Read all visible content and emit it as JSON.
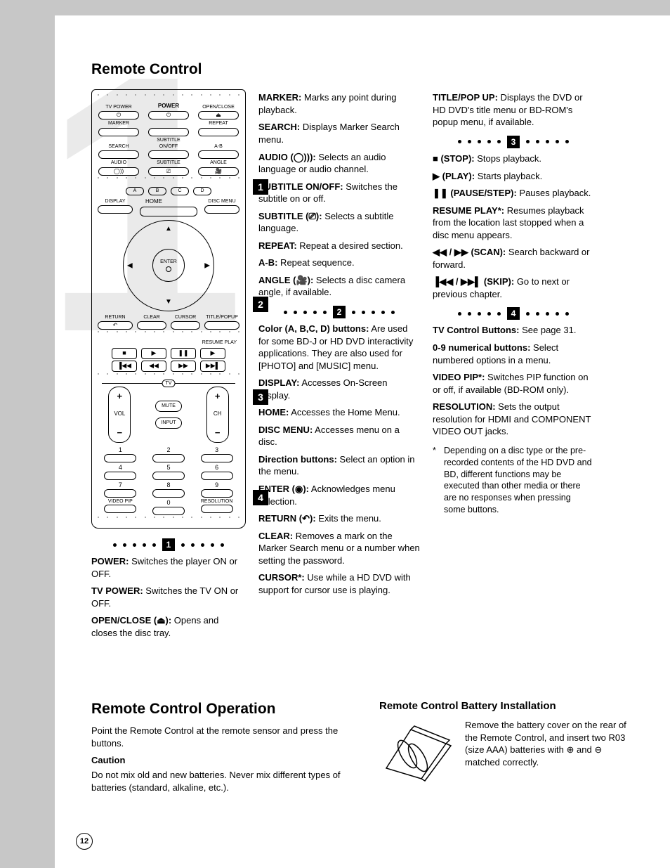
{
  "page_number": "12",
  "watermark": "1",
  "section1_title": "Remote Control",
  "markers": {
    "m1": "1",
    "m2": "2",
    "m3": "3",
    "m4": "4"
  },
  "remote": {
    "row1": [
      "TV POWER",
      "POWER",
      "OPEN/CLOSE"
    ],
    "row2": [
      "MARKER",
      "",
      "REPEAT"
    ],
    "row3": [
      "SEARCH",
      "SUBTITLE ON/OFF",
      "A-B"
    ],
    "row4": [
      "AUDIO",
      "SUBTITLE",
      "ANGLE"
    ],
    "colors": [
      "A",
      "B",
      "C",
      "D"
    ],
    "home": "HOME",
    "display": "DISPLAY",
    "discmenu": "DISC MENU",
    "enter": "ENTER",
    "return": "RETURN",
    "clear": "CLEAR",
    "cursor": "CURSOR",
    "titlepopup": "TITLE/POPUP",
    "resumeplay": "RESUME PLAY",
    "tv": "TV",
    "vol": "VOL",
    "ch": "CH",
    "mute": "MUTE",
    "input": "INPUT",
    "nums": [
      "1",
      "2",
      "3",
      "4",
      "5",
      "6",
      "7",
      "8",
      "9",
      "0"
    ],
    "videopip": "VIDEO PIP",
    "resolution": "RESOLUTION"
  },
  "col1_section1": [
    {
      "label": "POWER:",
      "text": " Switches the player ON or OFF."
    },
    {
      "label": "TV POWER:",
      "text": " Switches the TV ON or OFF."
    },
    {
      "label": "OPEN/CLOSE (",
      "sym": "⏏",
      "after": "):",
      "text": " Opens and closes the disc tray."
    }
  ],
  "col2_top": [
    {
      "label": "MARKER:",
      "text": " Marks any point during playback."
    },
    {
      "label": "SEARCH:",
      "text": " Displays Marker Search menu."
    },
    {
      "label": "AUDIO (",
      "sym": "◯))",
      "after": "):",
      "text": " Selects an audio language or audio channel."
    },
    {
      "label": "SUBTITLE ON/OFF:",
      "text": " Switches the subtitle on or off."
    },
    {
      "label": "SUBTITLE (",
      "sym": "⎚",
      "after": "):",
      "text": " Selects a subtitle language."
    },
    {
      "label": "REPEAT:",
      "text": " Repeat a desired section."
    },
    {
      "label": "A-B:",
      "text": " Repeat sequence."
    },
    {
      "label": "ANGLE (",
      "sym": "🎥",
      "after": "):",
      "text": " Selects a disc camera angle, if available."
    }
  ],
  "col2_section2": [
    {
      "label": "Color (A, B,C, D) buttons:",
      "text": " Are used for some BD-J or HD DVD interactivity applications. They are also used for [PHOTO] and [MUSIC] menu."
    },
    {
      "label": "DISPLAY:",
      "text": " Accesses On-Screen Display."
    },
    {
      "label": "HOME:",
      "text": " Accesses the Home Menu."
    },
    {
      "label": "DISC MENU:",
      "text": " Accesses menu on a disc."
    },
    {
      "label": "Direction buttons:",
      "text": " Select an option in the menu."
    },
    {
      "label": "ENTER (",
      "sym": "◉",
      "after": "):",
      "text": " Acknowledges menu selection."
    },
    {
      "label": "RETURN (",
      "sym": "↶",
      "after": "):",
      "text": " Exits the menu."
    },
    {
      "label": "CLEAR:",
      "text": " Removes a mark on the Marker Search menu or a number when setting the password."
    },
    {
      "label": "CURSOR*:",
      "text": " Use while a HD DVD with support for cursor use is playing."
    }
  ],
  "col3_top": [
    {
      "label": "TITLE/POP UP:",
      "text": " Displays the DVD or HD DVD's title menu or BD-ROM's popup menu, if available."
    }
  ],
  "col3_section3": [
    {
      "sym": "■",
      "label": " (STOP):",
      "text": " Stops playback."
    },
    {
      "sym": "▶",
      "label": " (PLAY):",
      "text": " Starts playback."
    },
    {
      "sym": "❚❚",
      "label": " (PAUSE/STEP):",
      "text": " Pauses playback."
    },
    {
      "label": "RESUME PLAY*:",
      "text": " Resumes playback from the location last stopped when a disc menu appears."
    },
    {
      "sym": "◀◀ / ▶▶",
      "label": " (SCAN):",
      "text": " Search backward or forward."
    },
    {
      "sym": "▐◀◀ / ▶▶▌",
      "label": " (SKIP):",
      "text": " Go to next or previous chapter."
    }
  ],
  "col3_section4": [
    {
      "label": "TV Control Buttons:",
      "text": " See page 31."
    },
    {
      "label": "0-9 numerical buttons:",
      "text": " Select numbered options in a menu."
    },
    {
      "label": "VIDEO PIP*:",
      "text": " Switches PIP function on or off, if available (BD-ROM only)."
    },
    {
      "label": "RESOLUTION:",
      "text": " Sets the output resolution for HDMI and COMPONENT VIDEO OUT jacks."
    }
  ],
  "col3_footnote": "Depending on a disc type or the pre-recorded contents of the HD DVD and BD, different functions may be executed than other media or there are no responses when pressing some buttons.",
  "section2_title": "Remote Control Operation",
  "section2_p1": "Point the Remote Control at the remote sensor and press the buttons.",
  "caution_label": "Caution",
  "caution_text": "Do not mix old and new batteries. Never mix different types of batteries (standard, alkaline, etc.).",
  "battery_title": "Remote Control Battery Installation",
  "battery_text_a": "Remove the battery cover on the rear of the Remote Control, and insert two R03 (size AAA) batteries with ",
  "battery_text_b": " and ",
  "battery_text_c": " matched correctly.",
  "plus_sym": "⊕",
  "minus_sym": "⊖"
}
